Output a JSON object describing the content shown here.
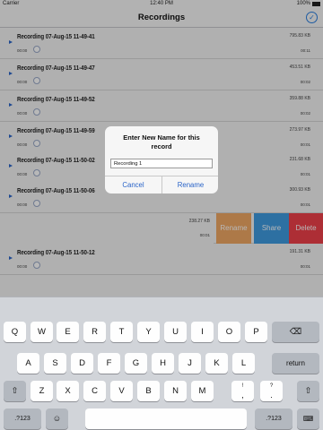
{
  "status_bar": {
    "carrier": "Carrier",
    "time": "12:40 PM",
    "battery": "100%"
  },
  "nav": {
    "title": "Recordings"
  },
  "recordings": [
    {
      "name": "Recording 07-Aug-15 11-49-41",
      "size": "795.83 KB",
      "start": "00:00",
      "duration": "00:11"
    },
    {
      "name": "Recording 07-Aug-15 11-49-47",
      "size": "453.51 KB",
      "start": "00:00",
      "duration": "00:02"
    },
    {
      "name": "Recording 07-Aug-15 11-49-52",
      "size": "359.88 KB",
      "start": "00:00",
      "duration": "00:02"
    },
    {
      "name": "Recording 07-Aug-15 11-49-59",
      "size": "273.97 KB",
      "start": "00:00",
      "duration": "00:01"
    },
    {
      "name": "Recording 07-Aug-15 11-50-02",
      "size": "231.68 KB",
      "start": "00:00",
      "duration": "00:01"
    },
    {
      "name": "Recording 07-Aug-15 11-50-06",
      "size": "300.93 KB",
      "start": "00:00",
      "duration": "00:01"
    }
  ],
  "swiped_row": {
    "size": "238.27 KB",
    "duration": "00:01",
    "actions": {
      "rename": "Rename",
      "share": "Share",
      "delete": "Delete"
    }
  },
  "last_recording": {
    "name": "Recording 07-Aug-15 11-50-12",
    "size": "191.31 KB",
    "start": "00:00",
    "duration": "00:01"
  },
  "alert": {
    "title_line1": "Enter New Name for this",
    "title_line2": "record",
    "input_value": "Recording 1",
    "cancel": "Cancel",
    "confirm": "Rename"
  },
  "keyboard": {
    "row1": [
      "Q",
      "W",
      "E",
      "R",
      "T",
      "Y",
      "U",
      "I",
      "O",
      "P"
    ],
    "row2": [
      "A",
      "S",
      "D",
      "F",
      "G",
      "H",
      "J",
      "K",
      "L"
    ],
    "row3": [
      "Z",
      "X",
      "C",
      "V",
      "B",
      "N",
      "M"
    ],
    "return": "return",
    "mode": ".?123",
    "punct1_top": "!",
    "punct1_bot": ",",
    "punct2_top": "?",
    "punct2_bot": "."
  }
}
